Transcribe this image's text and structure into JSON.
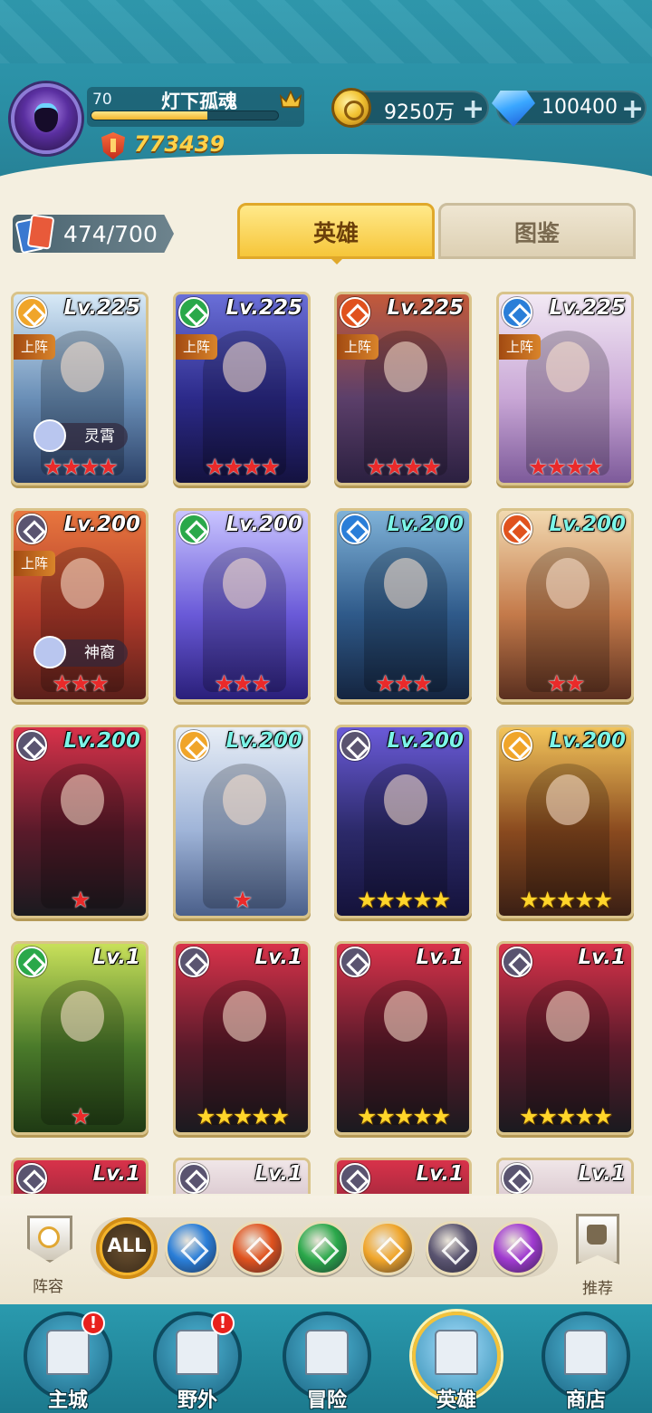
{
  "player": {
    "level": "70",
    "name": "灯下孤魂",
    "xp_fraction": 0.62,
    "power": "773439"
  },
  "currency": {
    "gold": "9250万",
    "diamonds": "100400",
    "plus_symbol": "+"
  },
  "collection": {
    "count": "474/700"
  },
  "tabs": {
    "heroes": "英雄",
    "codex": "图鉴",
    "active": "heroes"
  },
  "deployed_label": "上阵",
  "heroes": [
    {
      "level": "Lv.225",
      "faction": "light",
      "stars": 4,
      "star_type": "red",
      "deployed": true,
      "tag": "灵霄",
      "level_color": "#ffffff",
      "bg": [
        "#d7e9f7",
        "#6a8fb7",
        "#2a3f66"
      ]
    },
    {
      "level": "Lv.225",
      "faction": "wind",
      "stars": 4,
      "star_type": "red",
      "deployed": true,
      "tag": "",
      "level_color": "#ffffff",
      "bg": [
        "#6a6fd8",
        "#2c2a8a",
        "#14123f"
      ]
    },
    {
      "level": "Lv.225",
      "faction": "fire",
      "stars": 4,
      "star_type": "red",
      "deployed": true,
      "tag": "",
      "level_color": "#ffffff",
      "bg": [
        "#c45a3a",
        "#5c3f6a",
        "#2b2040"
      ]
    },
    {
      "level": "Lv.225",
      "faction": "water",
      "stars": 4,
      "star_type": "red",
      "deployed": true,
      "tag": "",
      "level_color": "#ffffff",
      "bg": [
        "#f2e9f4",
        "#c9a7d6",
        "#7d5a9a"
      ]
    },
    {
      "level": "Lv.200",
      "faction": "dark",
      "stars": 3,
      "star_type": "red",
      "deployed": true,
      "tag": "神裔",
      "level_color": "#ffffff",
      "bg": [
        "#e8763e",
        "#b03a2a",
        "#5a1f1a"
      ]
    },
    {
      "level": "Lv.200",
      "faction": "wind",
      "stars": 3,
      "star_type": "red",
      "deployed": false,
      "tag": "",
      "level_color": "#ffffff",
      "bg": [
        "#c9c4ff",
        "#6a5ad8",
        "#2a1f7a"
      ]
    },
    {
      "level": "Lv.200",
      "faction": "water",
      "stars": 3,
      "star_type": "red",
      "deployed": false,
      "tag": "",
      "level_color": "#7cf5e8",
      "bg": [
        "#7fb2d8",
        "#2f5a8a",
        "#14243f"
      ]
    },
    {
      "level": "Lv.200",
      "faction": "fire",
      "stars": 2,
      "star_type": "red",
      "deployed": false,
      "tag": "",
      "level_color": "#7cf5e8",
      "bg": [
        "#f2d9b0",
        "#c47a4a",
        "#5a2f1f"
      ]
    },
    {
      "level": "Lv.200",
      "faction": "dark",
      "stars": 1,
      "star_type": "red",
      "deployed": false,
      "tag": "",
      "level_color": "#7cf5e8",
      "bg": [
        "#d8324a",
        "#5a1a2a",
        "#1a1a1f"
      ]
    },
    {
      "level": "Lv.200",
      "faction": "light",
      "stars": 1,
      "star_type": "red",
      "deployed": false,
      "tag": "",
      "level_color": "#7cf5e8",
      "bg": [
        "#e8eef6",
        "#9fb4d8",
        "#4a5f8a"
      ]
    },
    {
      "level": "Lv.200",
      "faction": "dark",
      "stars": 5,
      "star_type": "gold",
      "deployed": false,
      "tag": "",
      "level_color": "#7cf5e8",
      "bg": [
        "#6a5ad8",
        "#2c2a6a",
        "#14123a"
      ]
    },
    {
      "level": "Lv.200",
      "faction": "light",
      "stars": 5,
      "star_type": "gold",
      "deployed": false,
      "tag": "",
      "level_color": "#7cf5e8",
      "bg": [
        "#f2c45a",
        "#8a4a1f",
        "#3a1f14"
      ]
    },
    {
      "level": "Lv.1",
      "faction": "wind",
      "stars": 1,
      "star_type": "red",
      "deployed": false,
      "tag": "",
      "level_color": "#ffffff",
      "bg": [
        "#c8e05a",
        "#4a7a2a",
        "#1f3a14"
      ]
    },
    {
      "level": "Lv.1",
      "faction": "dark",
      "stars": 5,
      "star_type": "gold",
      "deployed": false,
      "tag": "",
      "level_color": "#ffffff",
      "bg": [
        "#d8324a",
        "#5a1a2a",
        "#1a1a1f"
      ]
    },
    {
      "level": "Lv.1",
      "faction": "dark",
      "stars": 5,
      "star_type": "gold",
      "deployed": false,
      "tag": "",
      "level_color": "#ffffff",
      "bg": [
        "#d8324a",
        "#5a1a2a",
        "#1a1a1f"
      ]
    },
    {
      "level": "Lv.1",
      "faction": "dark",
      "stars": 5,
      "star_type": "gold",
      "deployed": false,
      "tag": "",
      "level_color": "#ffffff",
      "bg": [
        "#d8324a",
        "#5a1a2a",
        "#1a1a1f"
      ]
    },
    {
      "level": "Lv.1",
      "faction": "dark",
      "stars": 0,
      "star_type": "gold",
      "deployed": false,
      "tag": "",
      "level_color": "#ffffff",
      "bg": [
        "#d8324a",
        "#5a1a2a",
        "#1a1a1f"
      ]
    },
    {
      "level": "Lv.1",
      "faction": "dark",
      "stars": 0,
      "star_type": "gold",
      "deployed": false,
      "tag": "",
      "level_color": "#ffffff",
      "bg": [
        "#f0e6e8",
        "#b89aa8",
        "#6a4a5a"
      ]
    },
    {
      "level": "Lv.1",
      "faction": "dark",
      "stars": 0,
      "star_type": "gold",
      "deployed": false,
      "tag": "",
      "level_color": "#ffffff",
      "bg": [
        "#d8324a",
        "#5a1a2a",
        "#1a1a1f"
      ]
    },
    {
      "level": "Lv.1",
      "faction": "dark",
      "stars": 0,
      "star_type": "gold",
      "deployed": false,
      "tag": "",
      "level_color": "#ffffff",
      "bg": [
        "#f0e6e8",
        "#b89aa8",
        "#6a4a5a"
      ]
    }
  ],
  "faction_colors": {
    "light": "#f0a52a",
    "wind": "#2aa84a",
    "fire": "#e0521e",
    "water": "#2a7ed8",
    "dark": "#5a5470",
    "chaos": "#a03ad0"
  },
  "filters": {
    "roster_label": "阵容",
    "all_label": "ALL",
    "recommend_label": "推荐",
    "factions": [
      "water",
      "fire",
      "wind",
      "light",
      "dark",
      "chaos"
    ],
    "selected": "all"
  },
  "nav": [
    {
      "label": "主城",
      "icon": "castle-icon",
      "alert": true,
      "active": false
    },
    {
      "label": "野外",
      "icon": "portal-icon",
      "alert": true,
      "active": false
    },
    {
      "label": "冒险",
      "icon": "sword-icon",
      "alert": false,
      "active": false
    },
    {
      "label": "英雄",
      "icon": "helmet-icon",
      "alert": false,
      "active": true
    },
    {
      "label": "商店",
      "icon": "shop-icon",
      "alert": false,
      "active": false
    }
  ],
  "alert_symbol": "!",
  "star_symbol": "★"
}
